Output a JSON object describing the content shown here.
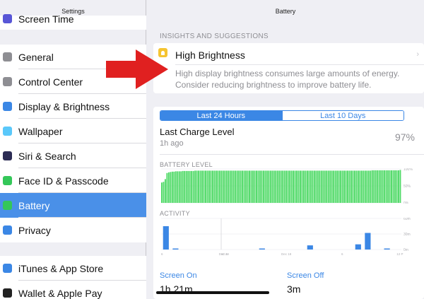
{
  "sidebar": {
    "title": "Settings",
    "partial_top_item": "Screen Time",
    "items": [
      {
        "label": "General",
        "icon": "gear-icon",
        "color": "#8e8e93"
      },
      {
        "label": "Control Center",
        "icon": "sliders-icon",
        "color": "#8e8e93"
      },
      {
        "label": "Display & Brightness",
        "icon": "display-icon",
        "color": "#3b87e5"
      },
      {
        "label": "Wallpaper",
        "icon": "wallpaper-icon",
        "color": "#5ac8fa"
      },
      {
        "label": "Siri & Search",
        "icon": "siri-icon",
        "color": "#2c2c54"
      },
      {
        "label": "Face ID & Passcode",
        "icon": "faceid-icon",
        "color": "#34c759"
      },
      {
        "label": "Battery",
        "icon": "battery-icon",
        "color": "#34c759"
      },
      {
        "label": "Privacy",
        "icon": "hand-icon",
        "color": "#3b87e5"
      }
    ],
    "items2": [
      {
        "label": "iTunes & App Store",
        "icon": "appstore-icon",
        "color": "#3b87e5"
      },
      {
        "label": "Wallet & Apple Pay",
        "icon": "wallet-icon",
        "color": "#222"
      }
    ],
    "selected_index": 6
  },
  "main": {
    "title": "Battery",
    "section_header": "INSIGHTS AND SUGGESTIONS",
    "insight": {
      "title": "High Brightness",
      "body": "High display brightness consumes large amounts of energy. Consider reducing brightness to improve battery life."
    },
    "segments": [
      "Last 24 Hours",
      "Last 10 Days"
    ],
    "selected_segment": 0,
    "last_charge": {
      "title": "Last Charge Level",
      "sub": "1h ago",
      "value": "97%"
    },
    "battery_level_label": "BATTERY LEVEL",
    "activity_label": "ACTIVITY",
    "screen_on": {
      "label": "Screen On",
      "value": "1h 21m"
    },
    "screen_off": {
      "label": "Screen Off",
      "value": "3m"
    }
  },
  "colors": {
    "accent": "#3b87e5",
    "selected_row": "#4a90e8",
    "battery_green": "#4cd964",
    "activity_blue": "#3b87e5",
    "arrow_red": "#e02020"
  },
  "chart_data": [
    {
      "type": "bar",
      "title": "BATTERY LEVEL",
      "y_tick_labels": [
        "100%",
        "50%",
        "0%"
      ],
      "ylim": [
        0,
        100
      ],
      "values": [
        60,
        62,
        70,
        88,
        90,
        91,
        92,
        92,
        93,
        93,
        93,
        93,
        94,
        94,
        94,
        94,
        94,
        94,
        94,
        95,
        95,
        95,
        95,
        95,
        95,
        95,
        95,
        95,
        95,
        95,
        95,
        95,
        95,
        95,
        95,
        95,
        95,
        95,
        95,
        95,
        95,
        95,
        95,
        95,
        95,
        95,
        95,
        95,
        95,
        95,
        95,
        95,
        95,
        95,
        95,
        95,
        95,
        95,
        95,
        95,
        95,
        95,
        95,
        95,
        95,
        95,
        95,
        95,
        95,
        95,
        95,
        95,
        95,
        95,
        95,
        95,
        95,
        95,
        95,
        95,
        95,
        95,
        95,
        95,
        95,
        95,
        95,
        95,
        95,
        95,
        95,
        95,
        95,
        95,
        95,
        95,
        95,
        95,
        95,
        95,
        95,
        95,
        95,
        95,
        95,
        95,
        95,
        95,
        95,
        95,
        95,
        95,
        95,
        95,
        95,
        95,
        95,
        95,
        95,
        95,
        96,
        96,
        96,
        96,
        96,
        96,
        96,
        96,
        96,
        96,
        96,
        96,
        96,
        96,
        96,
        96,
        97
      ]
    },
    {
      "type": "bar",
      "title": "ACTIVITY",
      "y_tick_labels": [
        "60m",
        "30m",
        "0m"
      ],
      "x_tick_labels": [
        "6",
        "Dec 19",
        "12 A",
        "Dec 18",
        "6",
        "12 P"
      ],
      "ylim": [
        0,
        60
      ],
      "values": [
        45,
        2,
        0,
        0,
        0,
        0,
        0,
        0,
        0,
        0,
        2,
        0,
        0,
        0,
        0,
        8,
        0,
        0,
        0,
        0,
        10,
        32,
        0,
        2,
        0
      ]
    }
  ]
}
